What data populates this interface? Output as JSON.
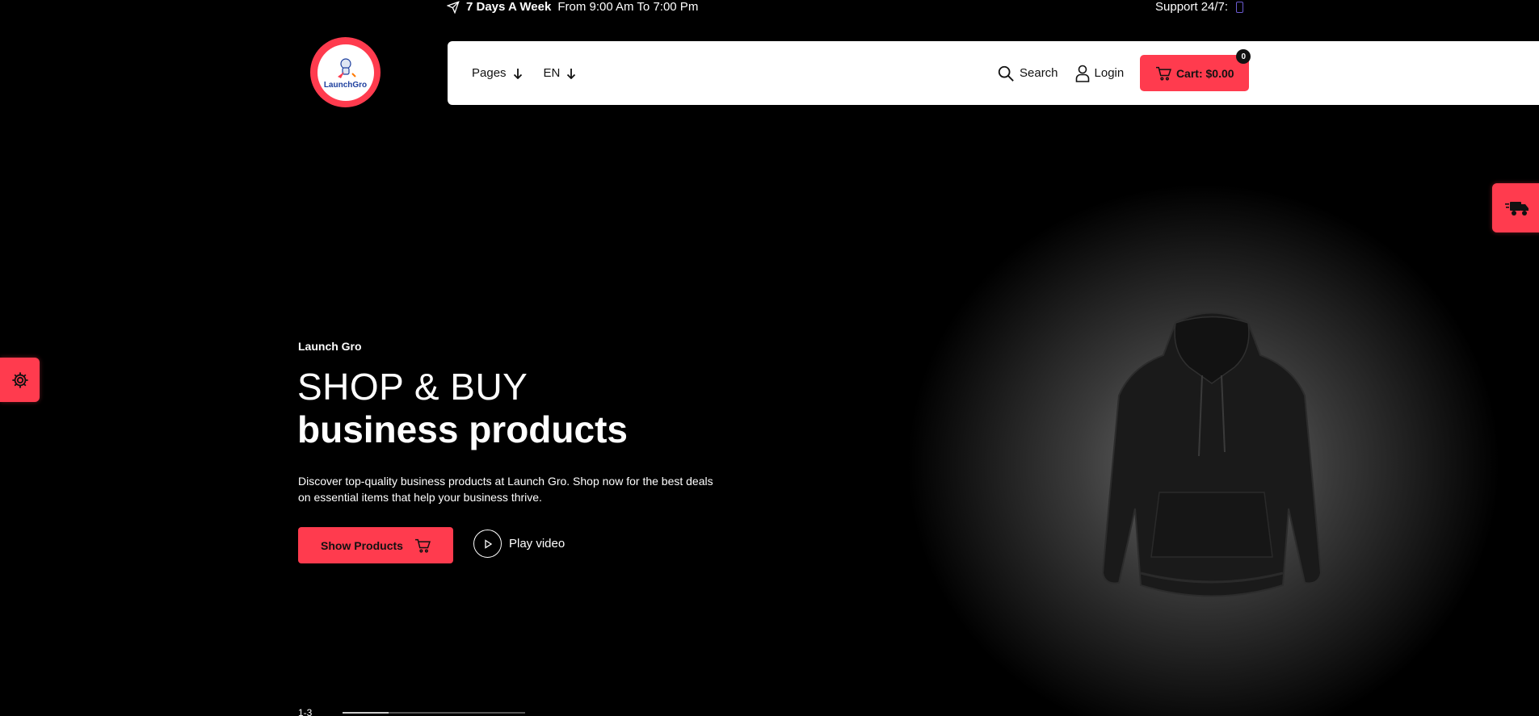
{
  "topbar": {
    "days": "7 Days A Week",
    "hours": "From 9:00 Am To 7:00 Pm",
    "support": "Support 24/7:"
  },
  "logo": {
    "text": "LaunchGro"
  },
  "nav": {
    "pages_label": "Pages",
    "lang_label": "EN",
    "search_label": "Search",
    "login_label": "Login",
    "cart_label": "Cart: $0.00",
    "cart_count": "0"
  },
  "hero": {
    "eyebrow": "Launch Gro",
    "title_line1": "SHOP & BUY",
    "title_line2": "business products",
    "description": "Discover top-quality business products at Launch Gro. Shop now for the best deals on essential items that help your business thrive.",
    "primary_button": "Show Products",
    "video_button": "Play video"
  },
  "slider": {
    "counter": "1-3",
    "progress_percent": 25
  },
  "colors": {
    "accent": "#ff3b4e",
    "background": "#000000",
    "navbar": "#ffffff"
  },
  "icons": [
    "send-icon",
    "phone-icon",
    "arrow-down-icon",
    "search-icon",
    "user-icon",
    "cart-icon",
    "delivery-truck-icon",
    "gear-icon",
    "play-icon"
  ]
}
